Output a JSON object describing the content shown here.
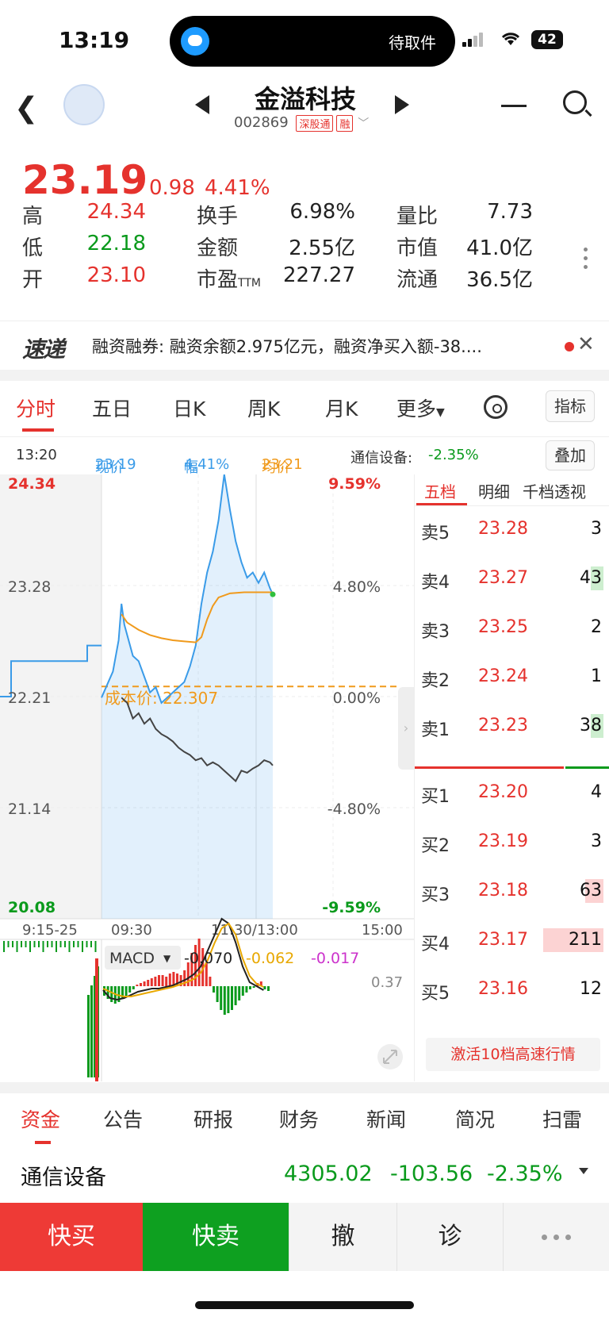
{
  "status": {
    "time": "13:19",
    "island_text": "待取件",
    "battery": "42"
  },
  "header": {
    "stock_name": "金溢科技",
    "stock_code": "002869",
    "tag_sgt": "深股通",
    "tag_margin": "融",
    "icons": [
      "back-icon",
      "avatar",
      "prev-icon",
      "next-icon",
      "menu-icon",
      "search-icon"
    ]
  },
  "quote": {
    "price": "23.19",
    "change": "0.98",
    "change_pct": "4.41%",
    "stats": [
      {
        "label": "高",
        "value": "24.34",
        "color": "red"
      },
      {
        "label": "换手",
        "value": "6.98%",
        "color": "black"
      },
      {
        "label": "量比",
        "value": "7.73",
        "color": "black"
      },
      {
        "label": "低",
        "value": "22.18",
        "color": "green"
      },
      {
        "label": "金额",
        "value": "2.55亿",
        "color": "black"
      },
      {
        "label": "市值",
        "value": "41.0亿",
        "color": "black"
      },
      {
        "label": "开",
        "value": "23.10",
        "color": "red"
      },
      {
        "label": "市盈",
        "label_sub": "TTM",
        "value": "227.27",
        "color": "black"
      },
      {
        "label": "流通",
        "value": "36.5亿",
        "color": "black"
      }
    ]
  },
  "ticker": {
    "logo": "速递",
    "text": "融资融券: 融资余额2.975亿元，融资净买入额-38...."
  },
  "chart_tabs": {
    "items": [
      "分时",
      "五日",
      "日K",
      "周K",
      "月K",
      "更多"
    ],
    "active": "分时",
    "indicator_button": "指标"
  },
  "info_row": {
    "time": "13:20",
    "now_label": "现价",
    "now_value": "23.19",
    "amp_label": "幅",
    "amp_value": "4.41%",
    "avg_label": "均价",
    "avg_value": "23.21",
    "sector_label": "通信设备:",
    "sector_value": "-2.35%",
    "overlay_button": "叠加"
  },
  "chart_data": {
    "type": "line",
    "y_left_ticks": [
      "24.34",
      "23.28",
      "22.21",
      "21.14",
      "20.08"
    ],
    "y_right_ticks": [
      "9.59%",
      "4.80%",
      "0.00%",
      "-4.80%",
      "-9.59%"
    ],
    "x_ticks": [
      "9:15-25",
      "09:30",
      "11:30/13:00",
      "15:00"
    ],
    "ylim": [
      20.08,
      24.34
    ],
    "cost_label": "成本价: 22.307",
    "cost_value": 22.307,
    "series": [
      {
        "name": "现价",
        "color": "#3a9be8",
        "x": [
          0,
          8,
          10,
          12,
          14,
          16,
          18,
          22,
          26,
          30,
          34,
          38,
          42,
          46,
          50,
          54,
          58,
          62,
          66,
          70,
          74,
          78,
          82,
          86,
          90,
          94,
          98,
          102,
          106,
          110,
          114,
          118,
          120
        ],
        "values": [
          22.2,
          22.45,
          22.6,
          22.75,
          23.1,
          22.9,
          22.8,
          22.6,
          22.55,
          22.4,
          22.25,
          22.3,
          22.15,
          22.2,
          22.25,
          22.3,
          22.35,
          22.5,
          22.7,
          23.1,
          23.4,
          23.6,
          23.9,
          24.34,
          24.0,
          23.7,
          23.5,
          23.35,
          23.4,
          23.3,
          23.4,
          23.25,
          23.19
        ]
      },
      {
        "name": "均价",
        "color": "#f09a1c",
        "x": [
          14,
          18,
          26,
          34,
          42,
          50,
          58,
          66,
          70,
          74,
          78,
          82,
          90,
          100,
          110,
          120
        ],
        "values": [
          23.0,
          22.92,
          22.85,
          22.8,
          22.77,
          22.75,
          22.74,
          22.73,
          22.78,
          22.95,
          23.08,
          23.16,
          23.2,
          23.21,
          23.21,
          23.21
        ]
      },
      {
        "color": "#444444",
        "x": [
          14,
          18,
          22,
          26,
          30,
          34,
          38,
          42,
          46,
          50,
          54,
          58,
          62,
          66,
          70,
          74,
          78,
          82,
          86,
          90,
          94,
          98,
          102,
          106,
          110,
          114,
          118,
          120
        ],
        "values": [
          22.2,
          22.15,
          22.0,
          22.05,
          21.95,
          22.0,
          21.9,
          21.85,
          21.82,
          21.78,
          21.72,
          21.68,
          21.65,
          21.6,
          21.62,
          21.55,
          21.58,
          21.55,
          21.5,
          21.45,
          21.4,
          21.5,
          21.48,
          21.52,
          21.55,
          21.6,
          21.58,
          21.55
        ]
      }
    ]
  },
  "macd": {
    "label": "MACD",
    "v1": "-0.070",
    "v2": "-0.062",
    "v3": "-0.017",
    "scale": "0.37",
    "colors": {
      "v1": "#222222",
      "v2": "#e8a800",
      "v3": "#cc33cc"
    }
  },
  "order_book": {
    "tabs": [
      "五档",
      "明细",
      "千档透视"
    ],
    "sells": [
      {
        "label": "卖5",
        "price": "23.28",
        "volume": "3",
        "bar": 0
      },
      {
        "label": "卖4",
        "price": "23.27",
        "volume": "43",
        "bar": 0.07
      },
      {
        "label": "卖3",
        "price": "23.25",
        "volume": "2",
        "bar": 0
      },
      {
        "label": "卖2",
        "price": "23.24",
        "volume": "1",
        "bar": 0
      },
      {
        "label": "卖1",
        "price": "23.23",
        "volume": "38",
        "bar": 0.07
      }
    ],
    "buys": [
      {
        "label": "买1",
        "price": "23.20",
        "volume": "4",
        "bar": 0
      },
      {
        "label": "买2",
        "price": "23.19",
        "volume": "3",
        "bar": 0
      },
      {
        "label": "买3",
        "price": "23.18",
        "volume": "63",
        "bar": 0.1
      },
      {
        "label": "买4",
        "price": "23.17",
        "volume": "211",
        "bar": 0.33
      },
      {
        "label": "买5",
        "price": "23.16",
        "volume": "12",
        "bar": 0
      }
    ],
    "activate": "激活10档高速行情"
  },
  "bottom_tabs": {
    "items": [
      "资金",
      "公告",
      "研报",
      "财务",
      "新闻",
      "简况",
      "扫雷"
    ],
    "active": "资金"
  },
  "sector": {
    "name": "通信设备",
    "value": "4305.02",
    "change": "-103.56",
    "change_pct": "-2.35%"
  },
  "actions": {
    "buy": "快买",
    "sell": "快卖",
    "cancel": "撤",
    "diagnose": "诊"
  },
  "colors": {
    "up": "#e5322d",
    "down": "#0a9a1c",
    "avg": "#f09a1c",
    "price_line": "#3a9be8"
  }
}
